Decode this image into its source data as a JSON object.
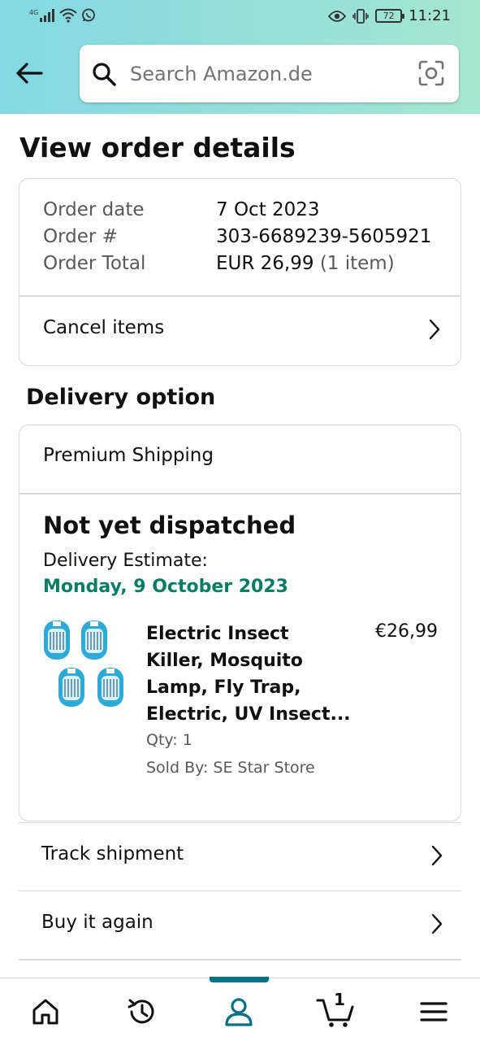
{
  "status_bar": {
    "network": "4G",
    "time": "11:21",
    "battery": "72"
  },
  "search": {
    "placeholder": "Search Amazon.de"
  },
  "page": {
    "title": "View order details"
  },
  "order": {
    "date_label": "Order date",
    "date_value": "7 Oct 2023",
    "number_label": "Order #",
    "number_value": "303-6689239-5605921",
    "total_label": "Order Total",
    "total_value": "EUR 26,99",
    "total_items": "(1 item)",
    "cancel_label": "Cancel items"
  },
  "delivery": {
    "section_title": "Delivery option",
    "shipping": "Premium Shipping",
    "status": "Not yet dispatched",
    "estimate_label": "Delivery Estimate:",
    "estimate_date": "Monday, 9 October 2023",
    "product": {
      "title_line1": "Electric Insect",
      "title_line2": "Killer, Mosquito",
      "title_line3": "Lamp, Fly Trap,",
      "title_line4": "Electric, UV Insect...",
      "price": "€26,99",
      "qty": "Qty: 1",
      "seller": "Sold By: SE Star Store"
    }
  },
  "actions": {
    "track": "Track shipment",
    "buy_again": "Buy it again"
  },
  "bottom_nav": {
    "active_tab": "account",
    "cart_count": "1"
  },
  "colors": {
    "accent": "#007185",
    "delivery_green": "#067d62",
    "header_gradient_start": "#82d8e3",
    "header_gradient_end": "#a5e6cf"
  },
  "icons": [
    "back-arrow-icon",
    "search-icon",
    "camera-icon",
    "chevron-right-icon",
    "home-icon",
    "history-icon",
    "account-icon",
    "cart-icon",
    "menu-icon"
  ]
}
